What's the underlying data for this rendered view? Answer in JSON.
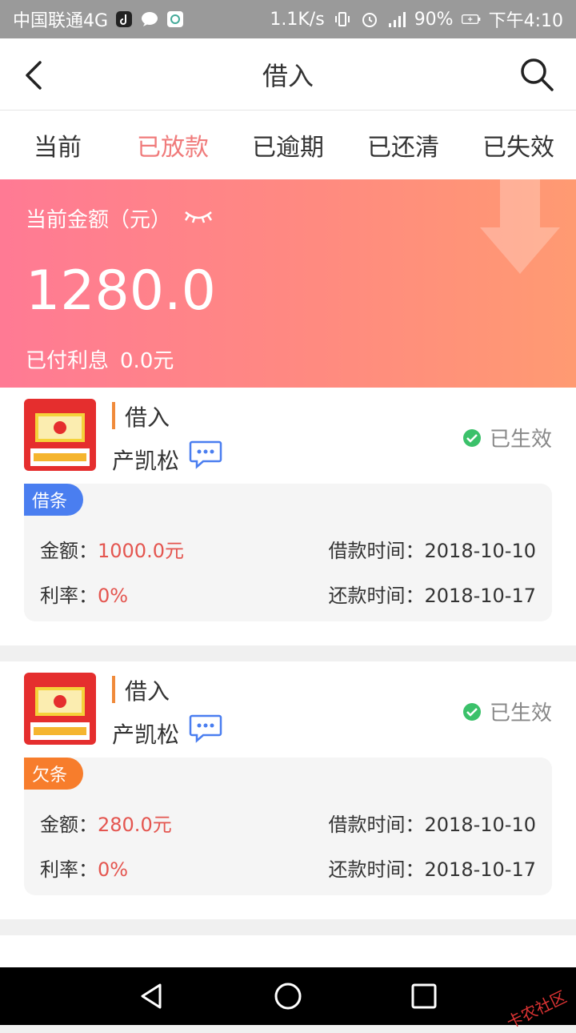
{
  "status_bar": {
    "carrier": "中国联通4G",
    "speed": "1.1K/s",
    "battery": "90%",
    "time": "下午4:10"
  },
  "header": {
    "title": "借入"
  },
  "tabs": [
    {
      "label": "当前",
      "active": false
    },
    {
      "label": "已放款",
      "active": true
    },
    {
      "label": "已逾期",
      "active": false
    },
    {
      "label": "已还清",
      "active": false
    },
    {
      "label": "已失效",
      "active": false
    }
  ],
  "summary": {
    "label": "当前金额（元）",
    "amount": "1280.0",
    "interest_label": "已付利息",
    "interest_value": "0.0元"
  },
  "cards": [
    {
      "type": "借入",
      "person": "产凯松",
      "status": "已生效",
      "tag": "借条",
      "tag_color": "#4a7ef0",
      "amount_label": "金额：",
      "amount": "1000.0元",
      "rate_label": "利率：",
      "rate": "0%",
      "borrow_label": "借款时间：",
      "borrow_date": "2018-10-10",
      "repay_label": "还款时间：",
      "repay_date": "2018-10-17"
    },
    {
      "type": "借入",
      "person": "产凯松",
      "status": "已生效",
      "tag": "欠条",
      "tag_color": "#f77d2c",
      "amount_label": "金额：",
      "amount": "280.0元",
      "rate_label": "利率：",
      "rate": "0%",
      "borrow_label": "借款时间：",
      "borrow_date": "2018-10-10",
      "repay_label": "还款时间：",
      "repay_date": "2018-10-17"
    }
  ],
  "watermark": "卡农社区",
  "colors": {
    "accent": "#f07b7b",
    "ok": "#3bc16a"
  }
}
